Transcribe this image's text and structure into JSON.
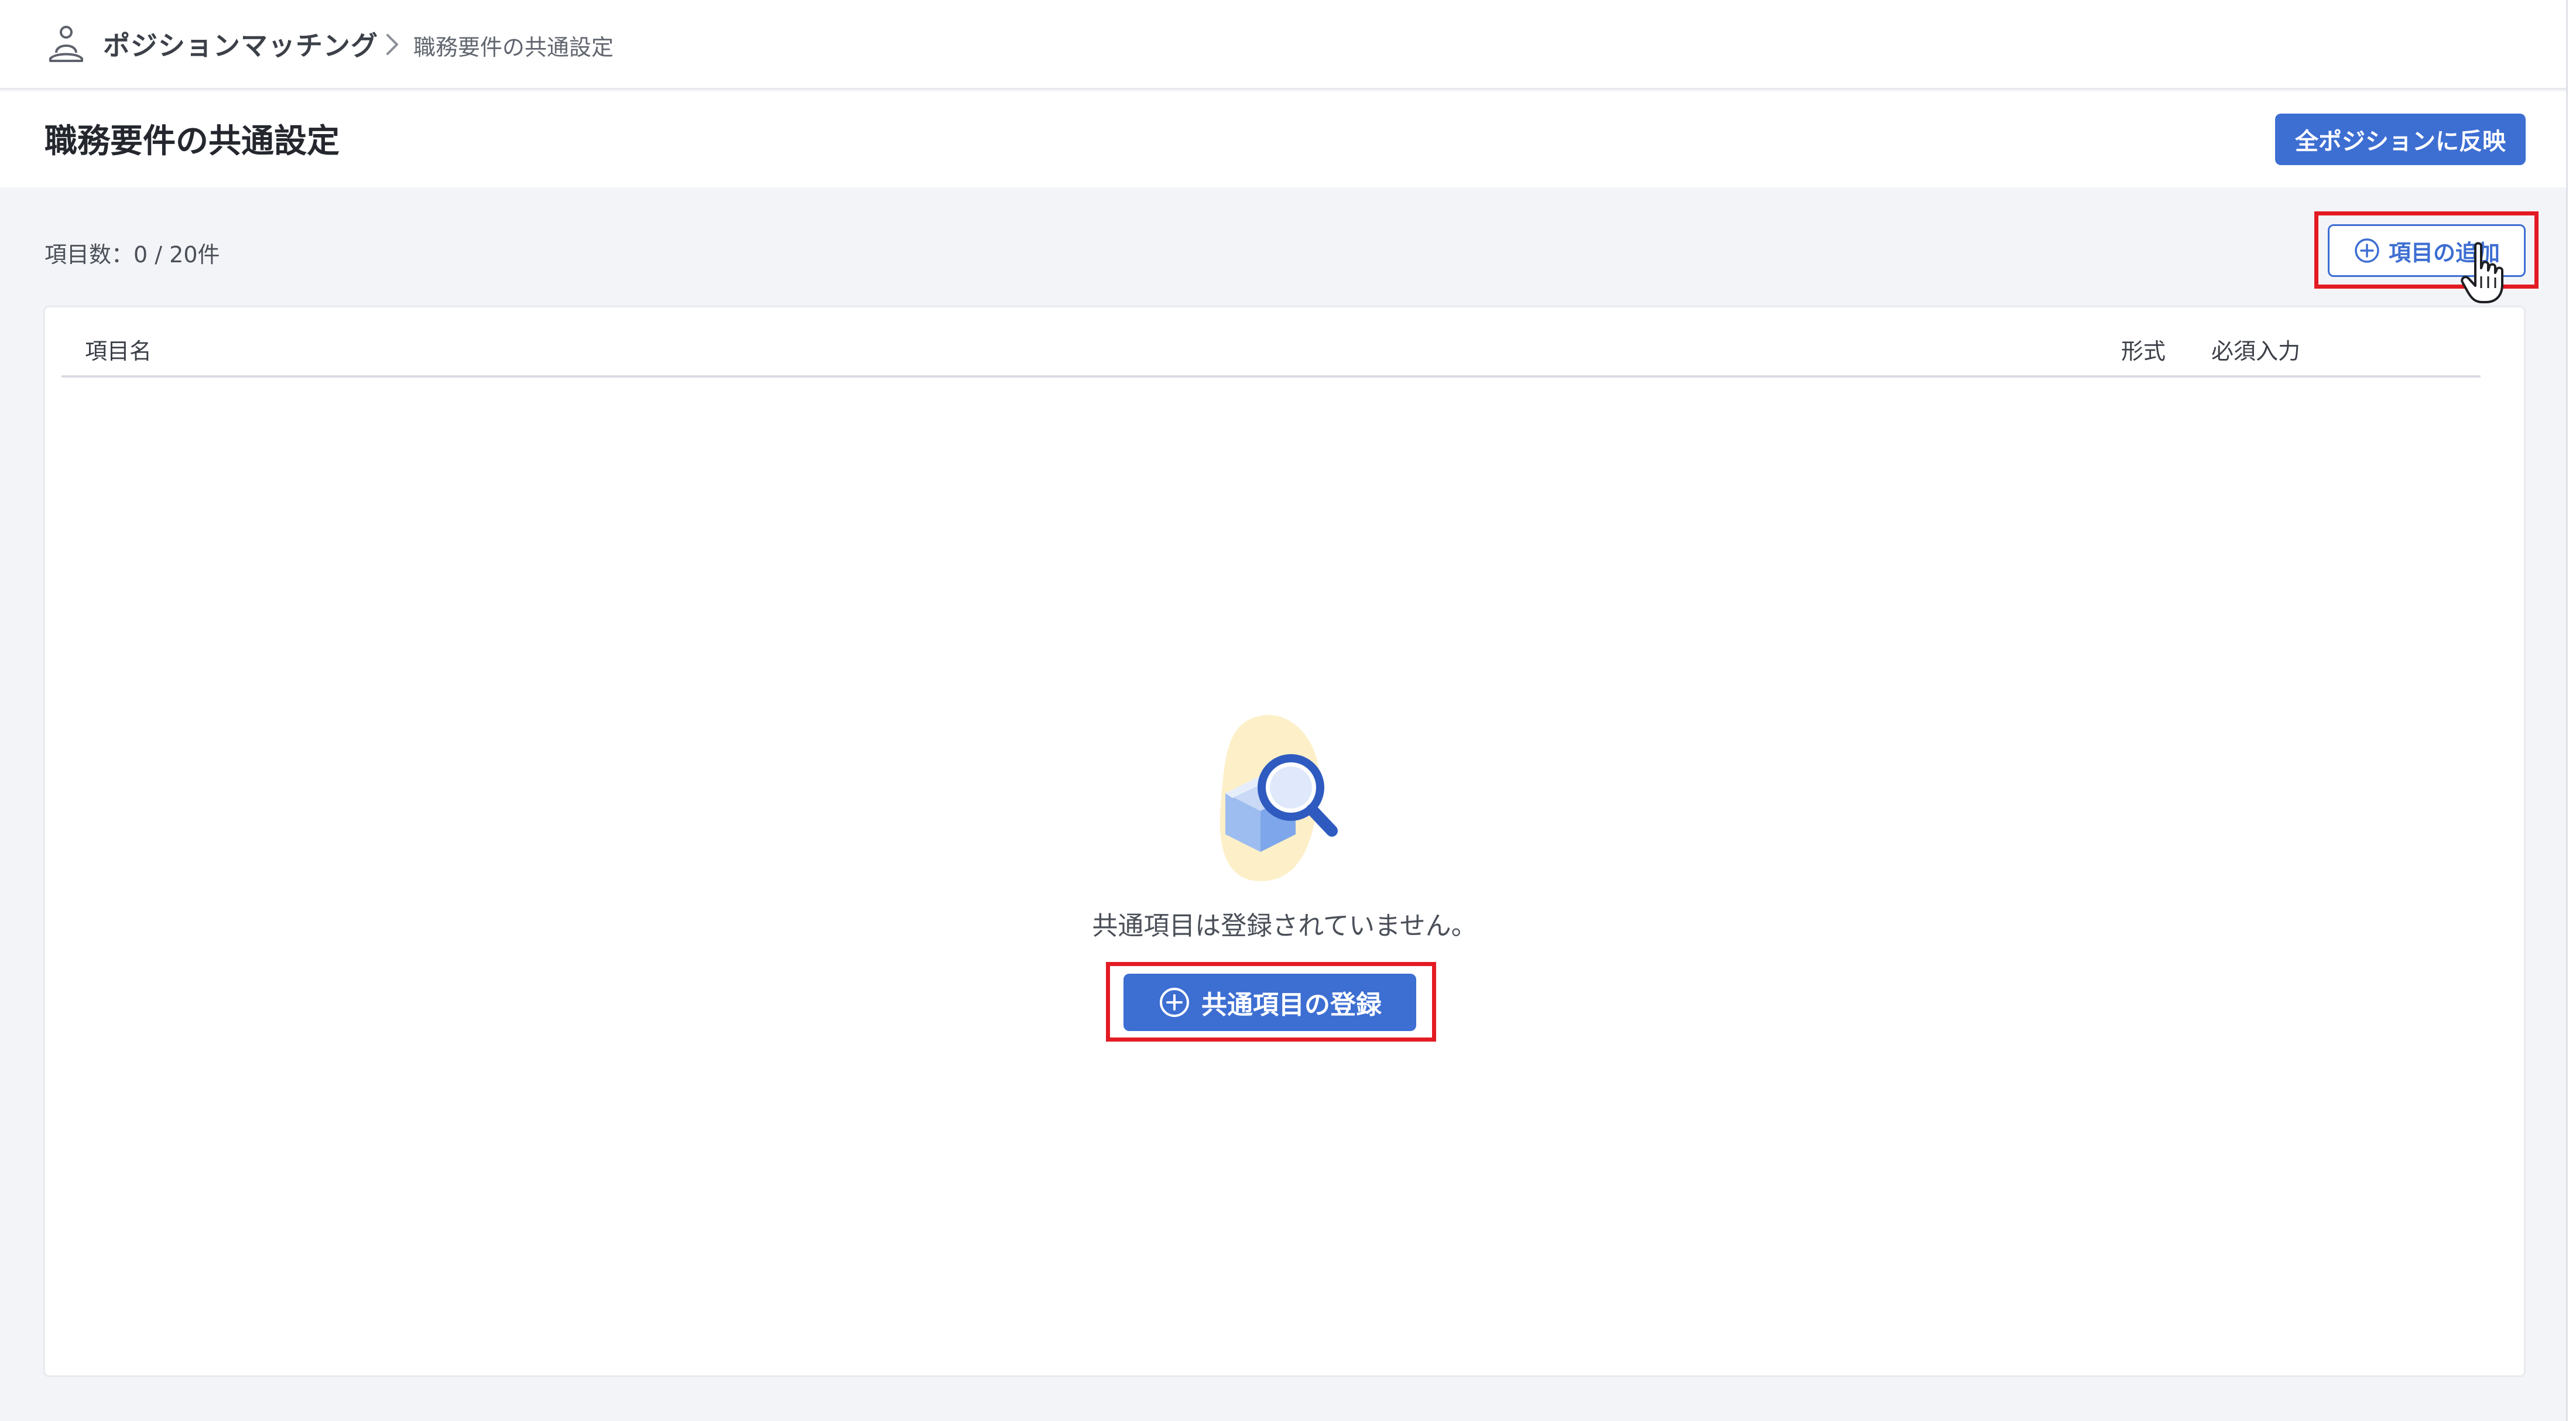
{
  "breadcrumb": {
    "app_name": "ポジションマッチング",
    "current": "職務要件の共通設定"
  },
  "header": {
    "title": "職務要件の共通設定",
    "apply_all_label": "全ポジションに反映"
  },
  "toolbar": {
    "count_label": "項目数：0 / 20件",
    "add_item_label": "項目の追加"
  },
  "table": {
    "columns": [
      "項目名",
      "形式",
      "必須入力"
    ]
  },
  "empty_state": {
    "message": "共通項目は登録されていません。",
    "register_label": "共通項目の登録"
  },
  "colors": {
    "primary": "#3d6ed2",
    "highlight": "#e31b23",
    "background": "#f3f4f7"
  },
  "icons": {
    "app": "person-sitting-icon",
    "separator": "chevron-right-icon",
    "add": "plus-circle-icon",
    "cursor": "hand-pointer-cursor-icon",
    "empty": "box-magnifier-illustration"
  }
}
